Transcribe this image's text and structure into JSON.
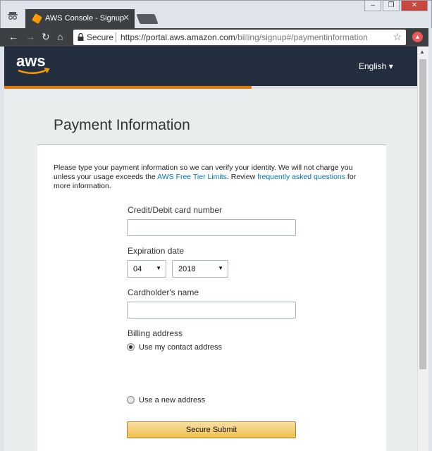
{
  "browser": {
    "tab_title": "AWS Console - Signup",
    "tab_close": "✕",
    "secure_label": "Secure",
    "url_scheme_host": "https://portal.aws.amazon.com",
    "url_path": "/billing/signup#/paymentinformation",
    "window_buttons": [
      "–",
      "❐",
      "✕"
    ]
  },
  "header": {
    "logo_text": "aws",
    "language": "English ▾"
  },
  "page": {
    "title": "Payment Information",
    "intro_part1": "Please type your payment information so we can verify your identity. We will not charge you unless your usage exceeds the ",
    "intro_link1": "AWS Free Tier Limits",
    "intro_part2": ". Review ",
    "intro_link2": "frequently asked questions",
    "intro_part3": " for more information."
  },
  "form": {
    "card_number_label": "Credit/Debit card number",
    "card_number_value": "",
    "expiration_label": "Expiration date",
    "exp_month": "04",
    "exp_year": "2018",
    "cardholder_label": "Cardholder's name",
    "cardholder_value": "",
    "billing_label": "Billing address",
    "billing_option_contact": "Use my contact address",
    "billing_option_new": "Use a new address",
    "submit_label": "Secure Submit"
  },
  "colors": {
    "header_bg": "#232f3e",
    "accent_orange": "#e47911",
    "link_blue": "#0073bb",
    "button_yellow": "#f0c14b"
  }
}
